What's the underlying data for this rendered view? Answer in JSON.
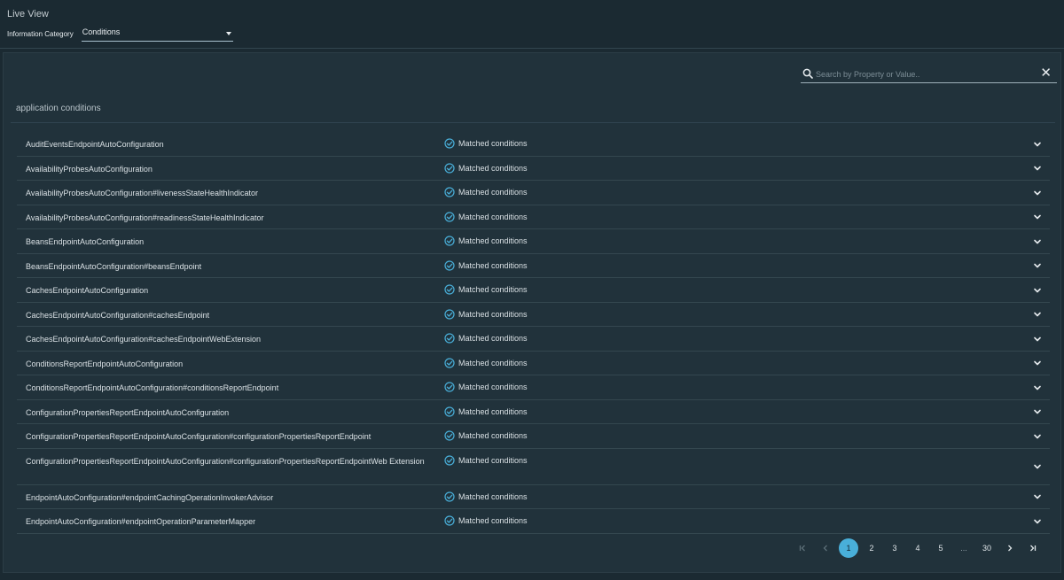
{
  "header": {
    "title": "Live View",
    "category_label": "Information Category",
    "category_value": "Conditions"
  },
  "search": {
    "placeholder": "Search by Property or Value..",
    "clear_glyph": "✕"
  },
  "section": {
    "title": "application conditions"
  },
  "status_color": "#49afd9",
  "rows": [
    {
      "name": "AuditEventsEndpointAutoConfiguration",
      "status": "Matched conditions"
    },
    {
      "name": "AvailabilityProbesAutoConfiguration",
      "status": "Matched conditions"
    },
    {
      "name": "AvailabilityProbesAutoConfiguration#livenessStateHealthIndicator",
      "status": "Matched conditions"
    },
    {
      "name": "AvailabilityProbesAutoConfiguration#readinessStateHealthIndicator",
      "status": "Matched conditions"
    },
    {
      "name": "BeansEndpointAutoConfiguration",
      "status": "Matched conditions"
    },
    {
      "name": "BeansEndpointAutoConfiguration#beansEndpoint",
      "status": "Matched conditions"
    },
    {
      "name": "CachesEndpointAutoConfiguration",
      "status": "Matched conditions"
    },
    {
      "name": "CachesEndpointAutoConfiguration#cachesEndpoint",
      "status": "Matched conditions"
    },
    {
      "name": "CachesEndpointAutoConfiguration#cachesEndpointWebExtension",
      "status": "Matched conditions"
    },
    {
      "name": "ConditionsReportEndpointAutoConfiguration",
      "status": "Matched conditions"
    },
    {
      "name": "ConditionsReportEndpointAutoConfiguration#conditionsReportEndpoint",
      "status": "Matched conditions"
    },
    {
      "name": "ConfigurationPropertiesReportEndpointAutoConfiguration",
      "status": "Matched conditions"
    },
    {
      "name": "ConfigurationPropertiesReportEndpointAutoConfiguration#configurationPropertiesReportEndpoint",
      "status": "Matched conditions"
    },
    {
      "name": "ConfigurationPropertiesReportEndpointAutoConfiguration#configurationPropertiesReportEndpointWeb Extension",
      "status": "Matched conditions",
      "tall": true
    },
    {
      "name": "EndpointAutoConfiguration#endpointCachingOperationInvokerAdvisor",
      "status": "Matched conditions"
    },
    {
      "name": "EndpointAutoConfiguration#endpointOperationParameterMapper",
      "status": "Matched conditions"
    }
  ],
  "pagination": {
    "pages": [
      "1",
      "2",
      "3",
      "4",
      "5"
    ],
    "ellipsis": "...",
    "last": "30",
    "current": "1"
  }
}
